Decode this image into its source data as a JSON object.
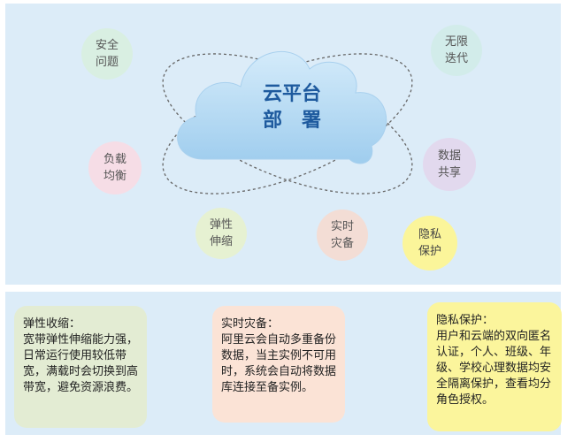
{
  "center": {
    "line1": "云平台",
    "line2": "部　署"
  },
  "features": {
    "security": "安全\n问题",
    "iterate": "无限\n迭代",
    "balance": "负载\n均衡",
    "share": "数据\n共享",
    "elastic": "弹性\n伸缩",
    "backup": "实时\n灾备",
    "privacy": "隐私\n保护"
  },
  "cards": {
    "elastic": {
      "title": "弹性收缩：",
      "body": "宽带弹性伸缩能力强，日常运行使用较低带宽，满载时会切换到高带宽，避免资源浪费。"
    },
    "backup": {
      "title": "实时灾备：",
      "body": "阿里云会自动多重备份数据，当主实例不可用时，系统会自动将数据库连接至备实例。"
    },
    "privacy": {
      "title": "隐私保护：",
      "body": "用户和云端的双向匿名认证，个人、班级、年级、学校心理数据均安全隔离保护，查看均分角色授权。"
    }
  },
  "colors": {
    "panel": "#dcecf8",
    "cloud": "#b7d9f1",
    "cloud_text": "#1e5a9e",
    "privacy_bubble": "#fbf59a"
  }
}
